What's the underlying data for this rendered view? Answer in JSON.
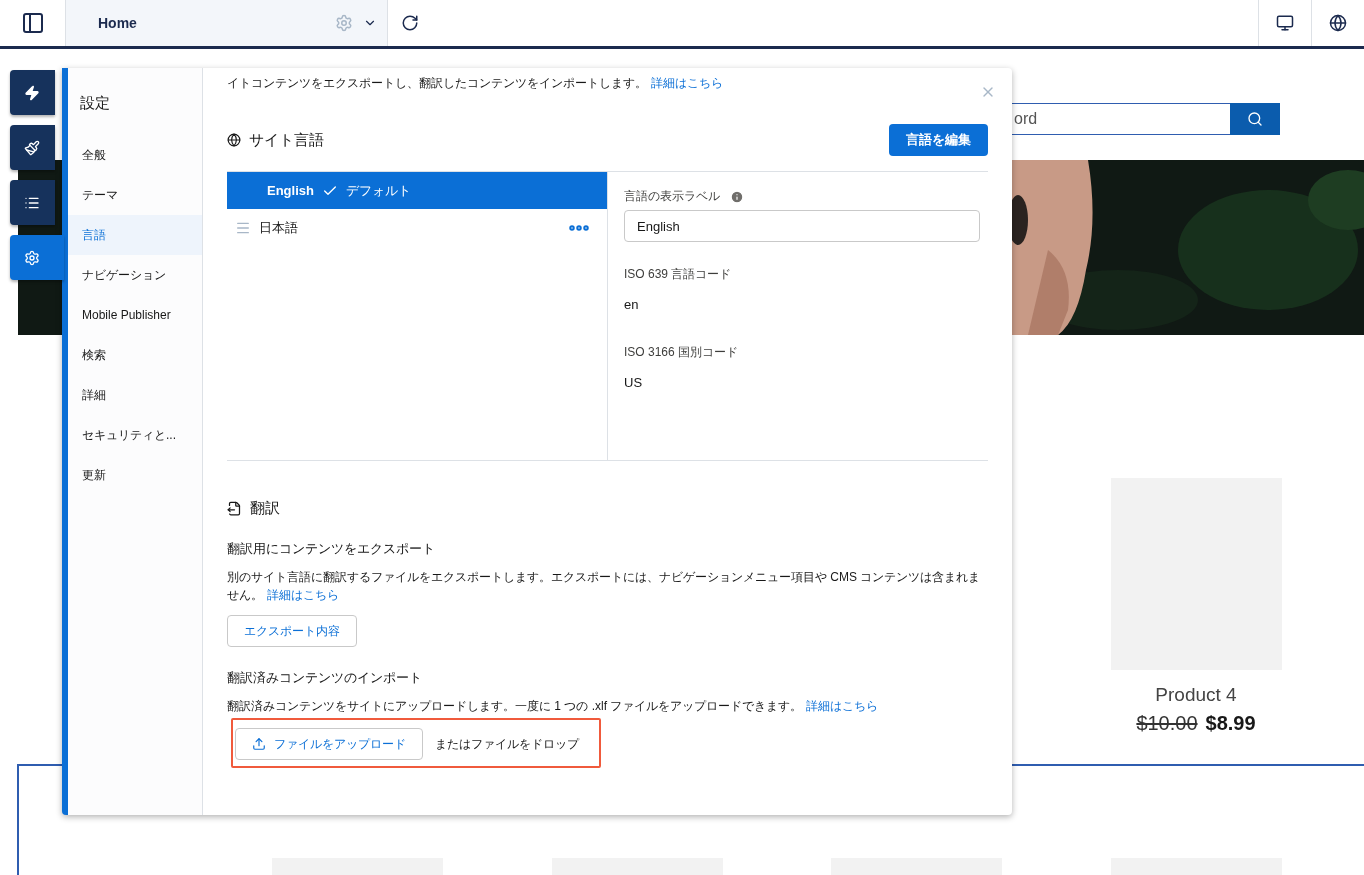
{
  "toolbar": {
    "page": "Home"
  },
  "canvas": {
    "search_placeholder": "ord",
    "products": [
      {
        "name": "Product 4",
        "list_price": "$10.00",
        "sale_price": "$8.99"
      }
    ]
  },
  "tool_rail": [
    {
      "kind": "bolt",
      "selected": false
    },
    {
      "kind": "brush",
      "selected": false
    },
    {
      "kind": "list",
      "selected": false
    },
    {
      "kind": "gear",
      "selected": true
    }
  ],
  "settings": {
    "title": "設定",
    "nav": [
      {
        "label": "全般",
        "selected": false
      },
      {
        "label": "テーマ",
        "selected": false
      },
      {
        "label": "言語",
        "selected": true
      },
      {
        "label": "ナビゲーション",
        "selected": false
      },
      {
        "label": "Mobile Publisher",
        "selected": false
      },
      {
        "label": "検索",
        "selected": false
      },
      {
        "label": "詳細",
        "selected": false
      },
      {
        "label": "セキュリティと...",
        "selected": false
      },
      {
        "label": "更新",
        "selected": false
      }
    ],
    "intro": "イトコンテンツをエクスポートし、翻訳したコンテンツをインポートします。",
    "intro_link": "詳細はこちら",
    "site_languages": {
      "heading": "サイト言語",
      "edit_button": "言語を編集",
      "languages": [
        {
          "name": "English",
          "default_label": "デフォルト",
          "selected": true
        },
        {
          "name": "日本語",
          "selected": false
        }
      ],
      "detail": {
        "display_label_caption": "言語の表示ラベル",
        "display_label_value": "English",
        "iso639_caption": "ISO 639 言語コード",
        "iso639_value": "en",
        "iso3166_caption": "ISO 3166 国別コード",
        "iso3166_value": "US"
      }
    },
    "translation": {
      "heading": "翻訳",
      "export_title": "翻訳用にコンテンツをエクスポート",
      "export_text": "別のサイト言語に翻訳するファイルをエクスポートします。エクスポートには、ナビゲーションメニュー項目や CMS コンテンツは含まれません。",
      "export_link": "詳細はこちら",
      "export_button": "エクスポート内容",
      "import_title": "翻訳済みコンテンツのインポート",
      "import_text": "翻訳済みコンテンツをサイトにアップロードします。一度に 1 つの .xlf ファイルをアップロードできます。",
      "import_link": "詳細はこちら",
      "upload_button": "ファイルをアップロード",
      "drop_text": "またはファイルをドロップ"
    }
  }
}
